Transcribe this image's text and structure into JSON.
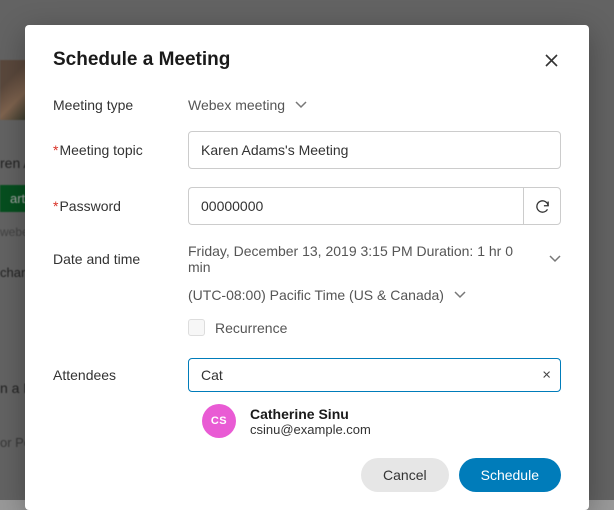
{
  "bg": {
    "name_fragment": "ren A",
    "pill": "art M",
    "webex": "webex",
    "chan": "chan",
    "meeting_frag": "n a M",
    "per": "or Pe"
  },
  "dialog": {
    "title": "Schedule a Meeting",
    "labels": {
      "meeting_type": "Meeting type",
      "meeting_topic": "Meeting topic",
      "password": "Password",
      "date_time": "Date and time",
      "attendees": "Attendees"
    },
    "meeting_type_value": "Webex meeting",
    "meeting_topic_value": "Karen Adams's Meeting",
    "password_value": "00000000",
    "datetime_value": "Friday, December 13, 2019 3:15 PM Duration: 1 hr 0 min",
    "timezone_value": "(UTC-08:00) Pacific Time (US & Canada)",
    "recurrence_label": "Recurrence",
    "attendee_search": "Cat",
    "suggestion": {
      "initials": "CS",
      "name": "Catherine Sinu",
      "email": "csinu@example.com"
    },
    "buttons": {
      "cancel": "Cancel",
      "schedule": "Schedule"
    }
  }
}
